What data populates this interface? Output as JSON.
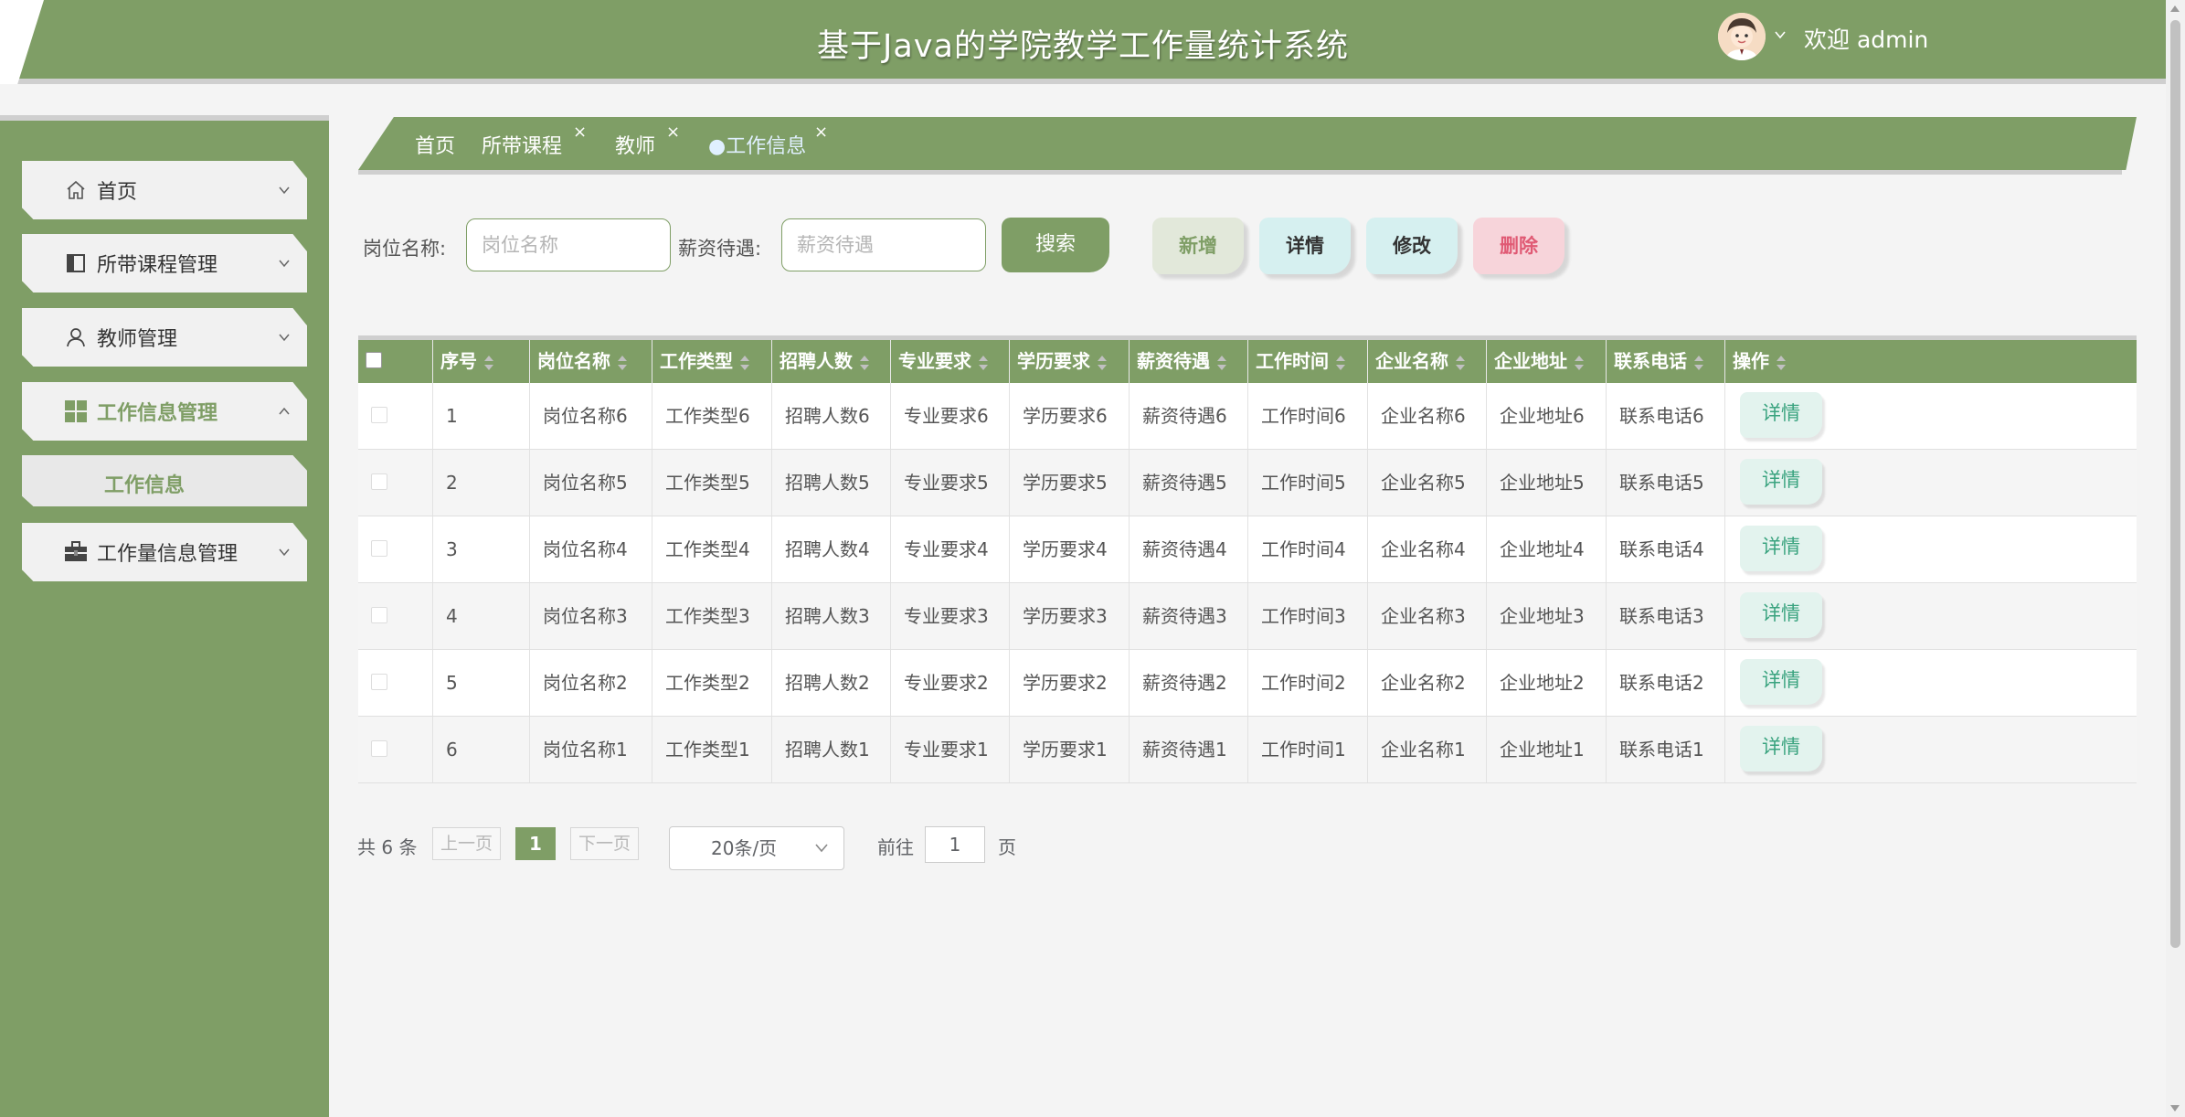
{
  "header": {
    "title": "基于Java的学院教学工作量统计系统",
    "welcome": "欢迎 admin"
  },
  "sidebar": {
    "items": [
      {
        "label": "首页",
        "icon": "home-icon"
      },
      {
        "label": "所带课程管理",
        "icon": "book-icon"
      },
      {
        "label": "教师管理",
        "icon": "user-icon"
      },
      {
        "label": "工作信息管理",
        "icon": "grid-icon",
        "active": true
      },
      {
        "label": "工作量信息管理",
        "icon": "briefcase-icon"
      }
    ],
    "submenu": {
      "label": "工作信息"
    }
  },
  "tabs": [
    {
      "label": "首页"
    },
    {
      "label": "所带课程"
    },
    {
      "label": "教师"
    },
    {
      "label": "●工作信息"
    }
  ],
  "search": {
    "label1": "岗位名称:",
    "placeholder1": "岗位名称",
    "label2": "薪资待遇:",
    "placeholder2": "薪资待遇",
    "button": "搜索"
  },
  "actions": {
    "add": "新增",
    "detail": "详情",
    "edit": "修改",
    "delete": "删除"
  },
  "table": {
    "columns": [
      "序号",
      "岗位名称",
      "工作类型",
      "招聘人数",
      "专业要求",
      "学历要求",
      "薪资待遇",
      "工作时间",
      "企业名称",
      "企业地址",
      "联系电话",
      "操作"
    ],
    "rows": [
      {
        "no": "1",
        "cells": [
          "岗位名称6",
          "工作类型6",
          "招聘人数6",
          "专业要求6",
          "学历要求6",
          "薪资待遇6",
          "工作时间6",
          "企业名称6",
          "企业地址6",
          "联系电话6"
        ],
        "action": "详情"
      },
      {
        "no": "2",
        "cells": [
          "岗位名称5",
          "工作类型5",
          "招聘人数5",
          "专业要求5",
          "学历要求5",
          "薪资待遇5",
          "工作时间5",
          "企业名称5",
          "企业地址5",
          "联系电话5"
        ],
        "action": "详情"
      },
      {
        "no": "3",
        "cells": [
          "岗位名称4",
          "工作类型4",
          "招聘人数4",
          "专业要求4",
          "学历要求4",
          "薪资待遇4",
          "工作时间4",
          "企业名称4",
          "企业地址4",
          "联系电话4"
        ],
        "action": "详情"
      },
      {
        "no": "4",
        "cells": [
          "岗位名称3",
          "工作类型3",
          "招聘人数3",
          "专业要求3",
          "学历要求3",
          "薪资待遇3",
          "工作时间3",
          "企业名称3",
          "企业地址3",
          "联系电话3"
        ],
        "action": "详情"
      },
      {
        "no": "5",
        "cells": [
          "岗位名称2",
          "工作类型2",
          "招聘人数2",
          "专业要求2",
          "学历要求2",
          "薪资待遇2",
          "工作时间2",
          "企业名称2",
          "企业地址2",
          "联系电话2"
        ],
        "action": "详情"
      },
      {
        "no": "6",
        "cells": [
          "岗位名称1",
          "工作类型1",
          "招聘人数1",
          "专业要求1",
          "学历要求1",
          "薪资待遇1",
          "工作时间1",
          "企业名称1",
          "企业地址1",
          "联系电话1"
        ],
        "action": "详情"
      }
    ]
  },
  "pagination": {
    "total": "共 6 条",
    "prev": "上一页",
    "page": "1",
    "next": "下一页",
    "page_size": "20条/页",
    "goto_label": "前往",
    "goto_value": "1",
    "goto_suffix": "页"
  },
  "colors": {
    "theme": "#7f9e66",
    "add_bg": "#e2e8da",
    "detail_bg": "#d6f0f0",
    "edit_bg": "#d6f0f0",
    "delete_bg": "#f7d4da",
    "delete_text": "#e05a74"
  }
}
